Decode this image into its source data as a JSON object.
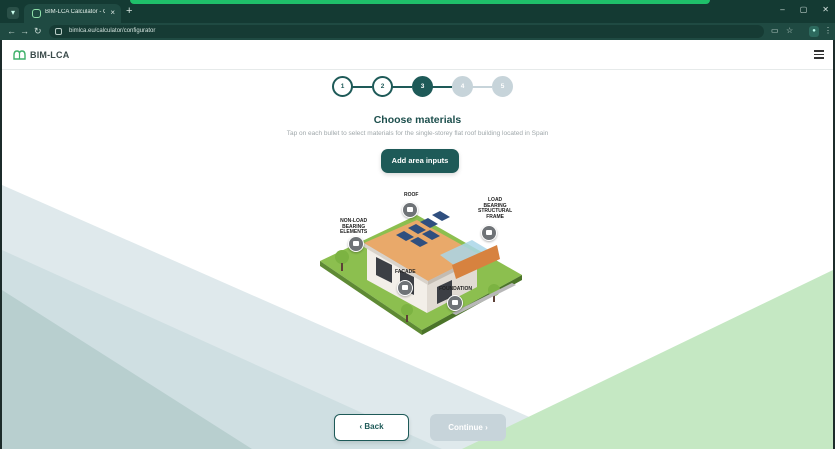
{
  "browser": {
    "tab_title": "BIM-LCA Calculator - Configur...",
    "tab_close": "×",
    "new_tab": "+",
    "url": "bimlca.eu/calculator/configurator",
    "window_controls": [
      "–",
      "▢",
      "✕"
    ]
  },
  "header": {
    "logo_text": "BIM-LCA"
  },
  "stepper": {
    "steps": [
      {
        "label": "1",
        "state": "done"
      },
      {
        "label": "2",
        "state": "done"
      },
      {
        "label": "3",
        "state": "active"
      },
      {
        "label": "4",
        "state": "todo"
      },
      {
        "label": "5",
        "state": "todo"
      }
    ]
  },
  "main": {
    "title": "Choose materials",
    "subtitle": "Tap on each bullet to select materials for the single-storey flat roof building located in Spain",
    "area_button": "Add area inputs"
  },
  "hotspots": {
    "roof": "ROOF",
    "non_load": [
      "NON-LOAD",
      "BEARING",
      "ELEMENTS"
    ],
    "load_bearing": [
      "LOAD",
      "BEARING",
      "STRUCTURAL",
      "FRAME"
    ],
    "facade": "FACADE",
    "foundation": "FOUNDATION"
  },
  "footer": {
    "back_label": "Back",
    "continue_label": "Continue",
    "back_icon": "‹",
    "continue_icon": "›"
  },
  "colors": {
    "primary": "#1e5a58",
    "disabled": "#c7d4da",
    "chrome": "#143a33",
    "accent_green": "#1fbf6a"
  }
}
